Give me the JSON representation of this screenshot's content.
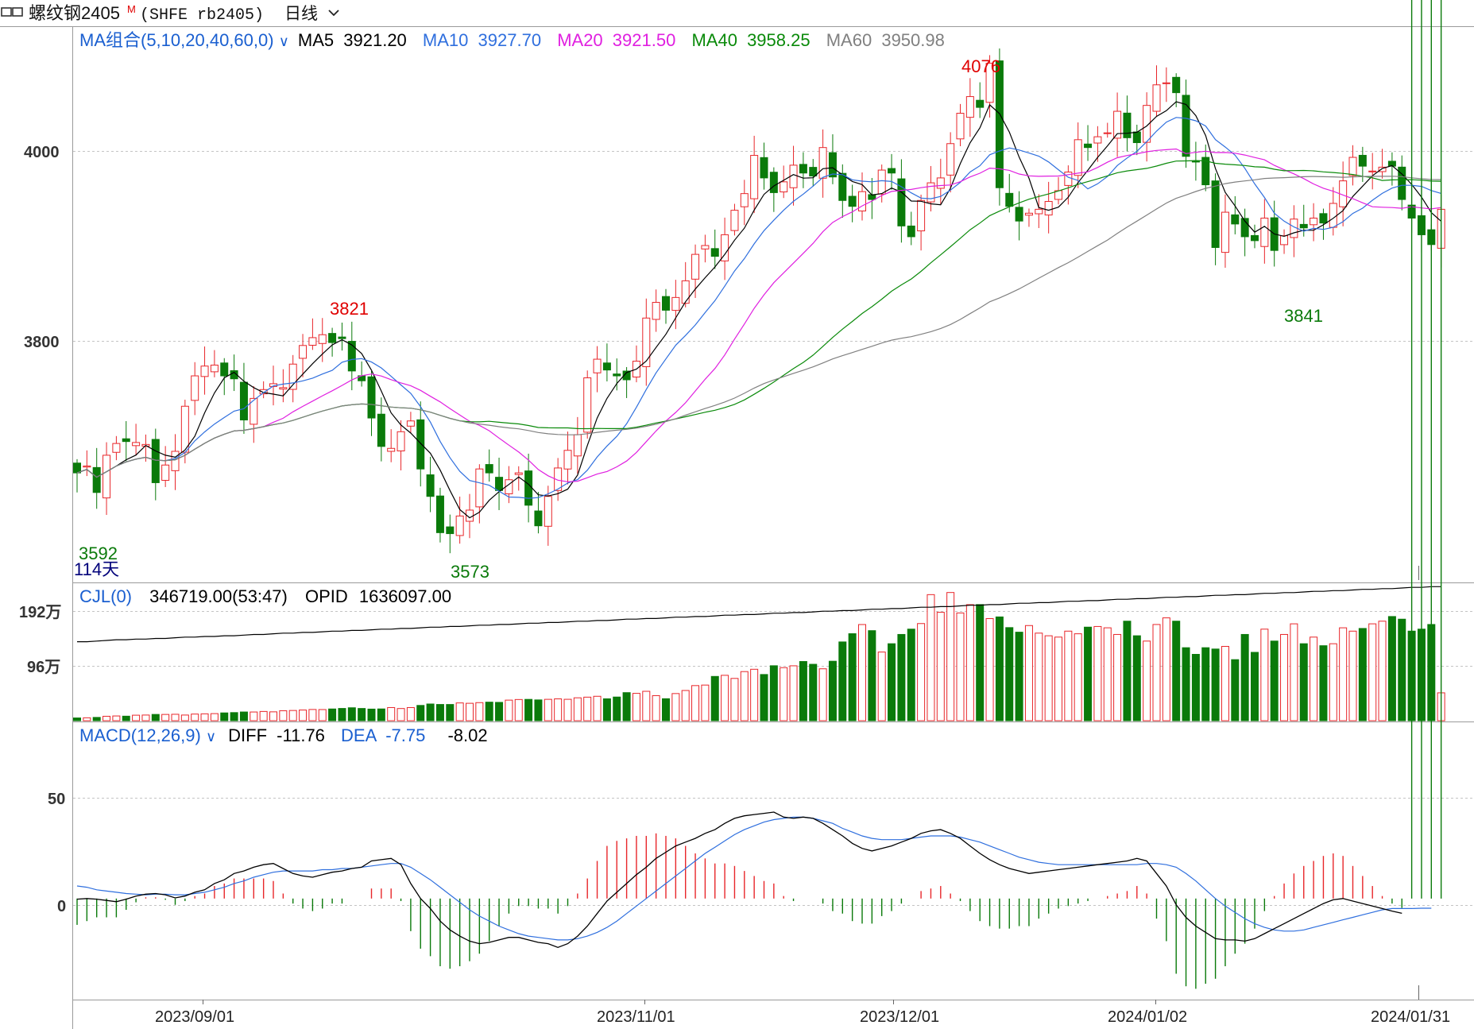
{
  "header": {
    "app_icon": "chart-window-icon",
    "symbol_name": "螺纹钢2405",
    "symbol_badge": "M",
    "symbol_code": "(SHFE rb2405)",
    "period": "日线",
    "period_icon": "chevron-down-icon"
  },
  "ma_legend": {
    "group_label": "MA组合(5,10,20,40,60,0)",
    "items": [
      {
        "label": "MA5",
        "value": "3921.20",
        "color": "#000000"
      },
      {
        "label": "MA10",
        "value": "3927.70",
        "color": "#2f6fde"
      },
      {
        "label": "MA20",
        "value": "3921.50",
        "color": "#e020e0"
      },
      {
        "label": "MA40",
        "value": "3958.25",
        "color": "#0a8a0a"
      },
      {
        "label": "MA60",
        "value": "3950.98",
        "color": "#808080"
      }
    ]
  },
  "vol_legend": {
    "label": "CJL(0)",
    "value": "346719.00(53:47)",
    "opi_label": "OPID",
    "opi_value": "1636097.00"
  },
  "macd_legend": {
    "label": "MACD(12,26,9)",
    "diff_label": "DIFF",
    "diff_value": "-11.76",
    "dea_label": "DEA",
    "dea_value": "-7.75",
    "macd_value": "-8.02"
  },
  "price_axis": {
    "ticks": [
      "4000",
      "3800"
    ]
  },
  "volume_axis": {
    "ticks": [
      "192万",
      "96万"
    ]
  },
  "macd_axis": {
    "ticks": [
      "50",
      "0"
    ]
  },
  "date_axis": {
    "ticks": [
      "2023/09/01",
      "2023/11/01",
      "2023/12/01",
      "2024/01/02",
      "2024/01/31"
    ]
  },
  "annotations": {
    "high1": "3821",
    "high2": "4076",
    "low1": "3592",
    "low2": "3573",
    "low3": "3841",
    "days": "114天"
  },
  "colors": {
    "up": "#e8262a",
    "down": "#0a7a0a",
    "grid": "#b8b8b8",
    "diff": "#000000",
    "dea": "#2f6fde",
    "legend_blue": "#1a5fd0",
    "high_label": "#e00000",
    "low_label": "#0a7a0a",
    "days_label": "#00007a"
  },
  "chart_data": [
    {
      "type": "candlestick",
      "ylim": [
        3543,
        4109
      ],
      "close": [
        3654,
        3661,
        3634,
        3672,
        3684,
        3686,
        3685,
        3683,
        3644,
        3662,
        3676,
        3722,
        3753,
        3763,
        3764,
        3753,
        3750,
        3708,
        3730,
        3739,
        3745,
        3741,
        3765,
        3784,
        3792,
        3795,
        3787,
        3791,
        3758,
        3748,
        3710,
        3681,
        3679,
        3696,
        3707,
        3658,
        3630,
        3593,
        3592,
        3610,
        3616,
        3658,
        3654,
        3636,
        3647,
        3654,
        3621,
        3600,
        3630,
        3659,
        3677,
        3693,
        3751,
        3770,
        3759,
        3753,
        3749,
        3768,
        3812,
        3828,
        3820,
        3833,
        3850,
        3877,
        3886,
        3875,
        3897,
        3922,
        3939,
        3978,
        3955,
        3940,
        3951,
        3968,
        3960,
        3957,
        3986,
        3956,
        3932,
        3926,
        3941,
        3933,
        3963,
        3960,
        3906,
        3895,
        3932,
        3950,
        3955,
        3990,
        4021,
        4038,
        4027,
        4072,
        3945,
        3926,
        3911,
        3919,
        3923,
        3931,
        3942,
        3961,
        3994,
        3986,
        3997,
        4001,
        4023,
        3996,
        3991,
        4029,
        4050,
        4052,
        4042,
        3977,
        3972,
        3948,
        3884,
        3920,
        3908,
        3895,
        3891,
        3914,
        3881,
        3896,
        3913,
        3904,
        3914,
        3909,
        3929,
        3952,
        3976,
        3967,
        3962,
        3966,
        3967,
        3933,
        3914,
        3897,
        3887,
        3923
      ]
    },
    {
      "type": "bar",
      "series": [
        {
          "values": [
            41400,
            43700,
            49400,
            66700,
            71300,
            68000,
            82800,
            85100,
            94300,
            94300,
            96600,
            85100,
            100000,
            103500,
            106700,
            117300,
            121900,
            131100,
            131100,
            139200,
            133400,
            150100,
            154000,
            160900,
            169000,
            167900,
            176600,
            184400,
            194700,
            184000,
            174800,
            177100,
            198000,
            183200,
            197800,
            230000,
            251600,
            244400,
            244100,
            267800,
            262200,
            272200,
            279500,
            276000,
            310000,
            319200,
            321000,
            313000,
            322000,
            329000,
            322500,
            345000,
            355000,
            368000,
            330000,
            356500,
            422800,
            412000,
            443000,
            377600,
            331200,
            409000,
            455400,
            529000,
            537000,
            667000,
            684000,
            637200,
            740000,
            775000,
            696000,
            828000,
            799800,
            827200,
            892000,
            850000,
            782000,
            896000,
            1187000,
            1311000,
            1449300,
            1357000,
            1035000,
            1160000,
            1300000,
            1380000,
            1464000,
            1900000,
            1634000,
            1932000,
            1624000,
            1749000,
            1750000,
            1539000,
            1564000,
            1403000,
            1334000,
            1434000,
            1320000,
            1280000,
            1260000,
            1350000,
            1310000,
            1410000,
            1420000,
            1400000,
            1300000,
            1500000,
            1280000,
            1200000,
            1450000,
            1550000,
            1500000,
            1100000,
            1000000,
            1100000,
            1080000,
            1120000,
            920000,
            1300000,
            1030000,
            1380000,
            1200000,
            1300000,
            1460000,
            1160000,
            1260000,
            1130000,
            1160000,
            1400000,
            1350000,
            1390000,
            1460000,
            1500000,
            1570000,
            1530000,
            1350000,
            1380000,
            1450000,
            420000
          ]
        },
        {
          "values": [
            1190000,
            1190000,
            1200000,
            1210000,
            1220000,
            1220000,
            1230000,
            1230000,
            1240000,
            1240000,
            1250000,
            1260000,
            1260000,
            1270000,
            1270000,
            1280000,
            1280000,
            1290000,
            1300000,
            1300000,
            1310000,
            1320000,
            1320000,
            1330000,
            1330000,
            1340000,
            1350000,
            1350000,
            1360000,
            1360000,
            1370000,
            1380000,
            1380000,
            1390000,
            1390000,
            1400000,
            1410000,
            1410000,
            1420000,
            1420000,
            1430000,
            1440000,
            1440000,
            1450000,
            1450000,
            1460000,
            1470000,
            1470000,
            1480000,
            1480000,
            1490000,
            1500000,
            1500000,
            1510000,
            1510000,
            1520000,
            1530000,
            1530000,
            1540000,
            1540000,
            1550000,
            1560000,
            1560000,
            1570000,
            1570000,
            1580000,
            1590000,
            1590000,
            1600000,
            1600000,
            1610000,
            1620000,
            1620000,
            1630000,
            1630000,
            1640000,
            1650000,
            1650000,
            1660000,
            1660000,
            1670000,
            1680000,
            1680000,
            1690000,
            1690000,
            1700000,
            1710000,
            1710000,
            1720000,
            1720000,
            1730000,
            1740000,
            1740000,
            1750000,
            1750000,
            1760000,
            1770000,
            1770000,
            1780000,
            1780000,
            1790000,
            1800000,
            1800000,
            1810000,
            1810000,
            1820000,
            1830000,
            1830000,
            1840000,
            1840000,
            1850000,
            1860000,
            1860000,
            1870000,
            1870000,
            1880000,
            1890000,
            1890000,
            1900000,
            1900000,
            1910000,
            1920000,
            1920000,
            1930000,
            1930000,
            1940000,
            1950000,
            1950000,
            1960000,
            1960000,
            1970000,
            1980000,
            1980000,
            1990000,
            1990000,
            2000000,
            2010000,
            2010000,
            2020000,
            2020000
          ]
        }
      ],
      "ylim": [
        0,
        2000000
      ]
    },
    {
      "type": "line",
      "series": [
        {
          "name": "DIFF",
          "values": [
            -0.5,
            0,
            -0.5,
            -1.5,
            -2.5,
            -0.5,
            2,
            3.5,
            4,
            3,
            0.5,
            2,
            5,
            7,
            12,
            15,
            20,
            22,
            25,
            27,
            28,
            24,
            20,
            18,
            17,
            19,
            21,
            22,
            24,
            25,
            30,
            31,
            32,
            27,
            12,
            0,
            -8,
            -18,
            -25,
            -30,
            -34,
            -36,
            -35,
            -33,
            -31,
            -31,
            -33,
            -35,
            -36,
            -39,
            -36,
            -30,
            -22,
            -12,
            -2,
            5,
            12,
            19,
            25,
            32,
            37,
            42,
            45,
            48,
            52,
            55,
            60,
            64,
            66,
            67,
            68,
            69,
            65,
            64,
            65,
            64,
            60,
            55,
            50,
            44,
            40,
            38,
            40,
            42,
            45,
            48,
            52,
            54,
            55,
            52,
            48,
            42,
            36,
            31,
            27,
            24,
            22,
            20,
            21,
            22,
            23,
            24,
            25,
            26,
            27,
            28,
            29,
            30,
            32,
            30,
            20,
            10,
            -5,
            -15,
            -22,
            -27,
            -32,
            -33,
            -33,
            -34,
            -32,
            -28,
            -24,
            -20,
            -16,
            -12,
            -8,
            -4,
            -1,
            0,
            -2,
            -4,
            -6,
            -8,
            -10,
            -11.76
          ]
        },
        {
          "name": "DEA",
          "values": [
            10,
            9,
            7,
            6,
            5,
            4,
            3.5,
            3,
            3.5,
            3.5,
            3,
            3,
            4,
            5,
            7,
            9,
            12,
            14,
            17,
            19,
            21,
            22,
            22,
            22,
            22,
            23,
            23,
            24,
            24,
            25,
            26,
            27,
            28,
            28,
            25,
            20,
            15,
            9,
            3,
            -3,
            -9,
            -14,
            -18,
            -22,
            -25,
            -28,
            -30,
            -31,
            -32,
            -33,
            -33,
            -32,
            -30,
            -27,
            -23,
            -18,
            -12,
            -6,
            0,
            6,
            12,
            18,
            24,
            30,
            36,
            41,
            46,
            51,
            55,
            58,
            61,
            63,
            64,
            65,
            65,
            64,
            62,
            60,
            56,
            53,
            50,
            48,
            47,
            47,
            47,
            48,
            49,
            50,
            50,
            50,
            49,
            47,
            45,
            42,
            39,
            36,
            33,
            31,
            29,
            28,
            27,
            27,
            27,
            27,
            27,
            27,
            27,
            27,
            27,
            28,
            28,
            27,
            25,
            20,
            14,
            7,
            0,
            -6,
            -11,
            -16,
            -20,
            -23,
            -25,
            -26,
            -26,
            -25,
            -23,
            -21,
            -19,
            -17,
            -15,
            -13,
            -11,
            -9,
            -8,
            -8,
            -8,
            -7.75,
            -7.75
          ]
        }
      ],
      "ylim": [
        -80,
        140
      ]
    }
  ]
}
